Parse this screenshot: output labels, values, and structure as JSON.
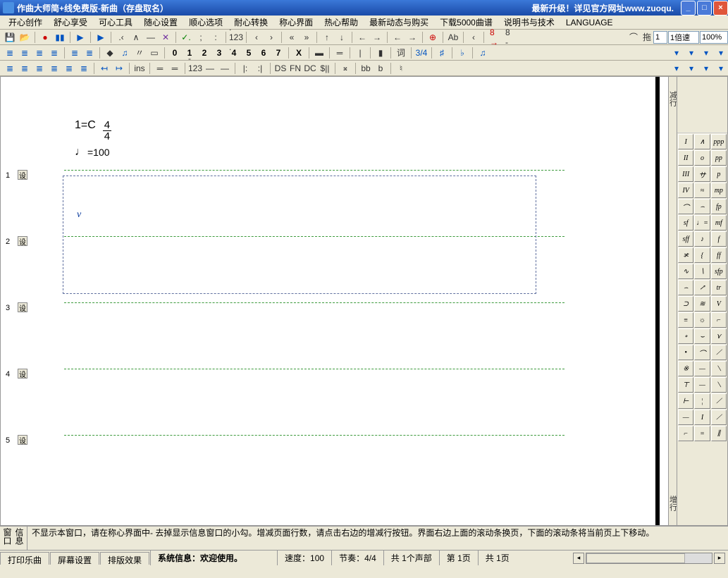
{
  "window": {
    "title": "作曲大师简+线免费版-新曲（存盘取名）",
    "upgrade_text": "最新升级！详见官方网址www.zuoqu."
  },
  "menu": {
    "items": [
      "开心创作",
      "舒心享受",
      "可心工具",
      "随心设置",
      "顺心选项",
      "耐心转换",
      "称心界面",
      "热心帮助",
      "最新动态与购买",
      "下载5000曲谱",
      "说明书与技术",
      "LANGUAGE"
    ]
  },
  "toolbar1": {
    "numbers_label": ". 123 .",
    "ab_label": "Ab",
    "eight_minus": "8 →",
    "eight_minus2": "8 -",
    "tuo_label": "拖",
    "tuo_value": "1",
    "speed_label": "1倍速",
    "zoom": "100%"
  },
  "toolbar2": {
    "digits": [
      "0",
      "1",
      "2",
      "3",
      "4",
      "5",
      "6",
      "7"
    ],
    "x_label": "X",
    "ci_label": "词",
    "time_sig": "3/4"
  },
  "toolbar3": {
    "ins_label": "ins",
    "neg123": "- 123 -",
    "ds_label": "DS",
    "fn_label": "FN",
    "dc_label": "DC",
    "dollar_label": "$||",
    "bb_label": "bb",
    "b_label": "b"
  },
  "side_labels": {
    "top": "减行",
    "bottom": "增行"
  },
  "score": {
    "key": "1=C",
    "time_top": "4",
    "time_bot": "4",
    "tempo_value": "=100",
    "v_marker": "v",
    "rows": [
      {
        "num": "1",
        "mark": "设"
      },
      {
        "num": "2",
        "mark": "设"
      },
      {
        "num": "3",
        "mark": "设"
      },
      {
        "num": "4",
        "mark": "设"
      },
      {
        "num": "5",
        "mark": "设"
      }
    ]
  },
  "palette": {
    "cells": [
      "I",
      "∧",
      "ppp",
      "II",
      "o",
      "pp",
      "III",
      "サ",
      "p",
      "IV",
      "≈",
      "mp",
      "⌒",
      "⌢",
      "fp",
      "sf",
      "♩=",
      "mf",
      "sff",
      "♪",
      "f",
      "≭",
      "{",
      "ff",
      "∿",
      "∖",
      "sfp",
      "⌢",
      "↗",
      "tr",
      "⊃",
      "≋",
      "V",
      "≡",
      "☼",
      "⌐",
      "∘",
      "⌣",
      "⋎",
      "•",
      "⌒",
      "⟋",
      "※",
      "—",
      "⟍",
      "⊤",
      "—",
      "⟍",
      "⊢",
      "¦",
      "⟋",
      "—",
      "I",
      "⟋",
      "⌐",
      "=",
      "∥"
    ]
  },
  "info_panel": {
    "label": "信息窗口",
    "text": "不显示本窗口，请在称心界面中- 去掉显示信息窗口的小勾。增减页面行数，请点击右边的增减行按钮。界面右边上面的滚动条换页，下面的滚动条将当前页上下移动。"
  },
  "statusbar": {
    "tabs": [
      "打印乐曲",
      "屏幕设置",
      "排版效果"
    ],
    "system_info": "系统信息：欢迎使用。",
    "speed": "速度：100",
    "beat": "节奏：4/4",
    "voices": "共 1个声部",
    "page_current": "第 1页",
    "page_total": "共 1页"
  }
}
